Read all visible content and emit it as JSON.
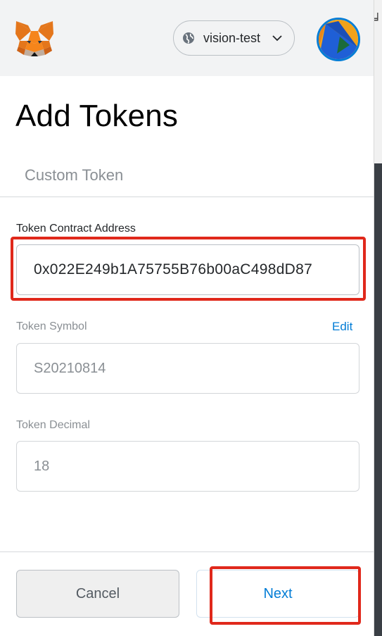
{
  "header": {
    "network_label": "vision-test",
    "logo": "metamask-fox-icon",
    "network_icon": "globe-icon",
    "dropdown_icon": "chevron-down-icon"
  },
  "page": {
    "title": "Add Tokens",
    "tab_custom_token": "Custom Token"
  },
  "form": {
    "address_label": "Token Contract Address",
    "address_value": "0x022E249b1A75755B76b00aC498dD87",
    "symbol_label": "Token Symbol",
    "symbol_edit": "Edit",
    "symbol_value": "S20210814",
    "decimal_label": "Token Decimal",
    "decimal_value": "18"
  },
  "footer": {
    "cancel_label": "Cancel",
    "next_label": "Next"
  },
  "colors": {
    "accent": "#037dd6",
    "annotation": "#e0281b",
    "header_bg": "#f2f3f4"
  }
}
